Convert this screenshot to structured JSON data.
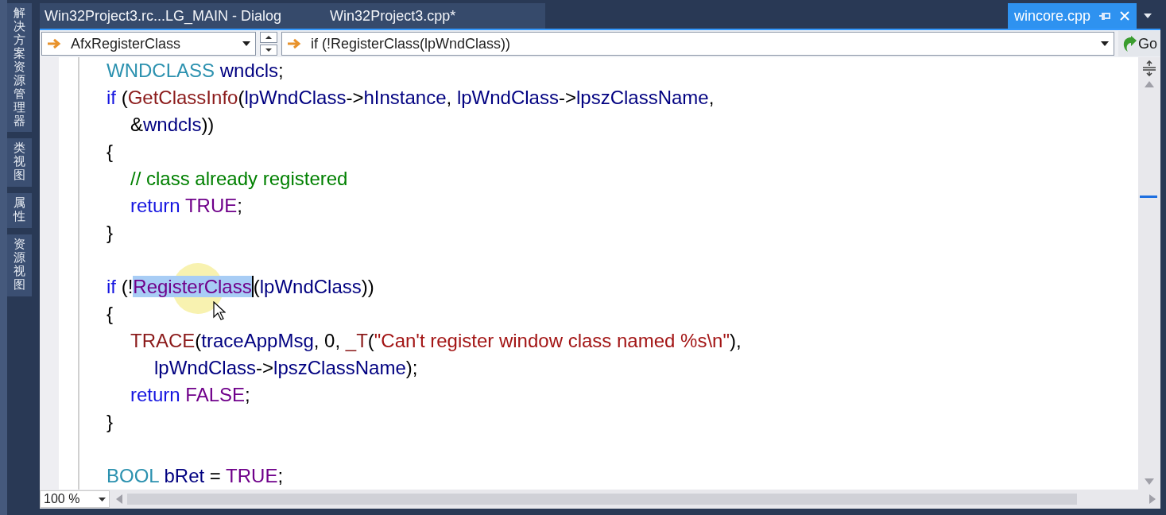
{
  "sidebar": {
    "tabs": [
      {
        "label": "解决方案资源管理器"
      },
      {
        "label": "类视图"
      },
      {
        "label": "属性"
      },
      {
        "label": "资源视图"
      }
    ]
  },
  "tabs": [
    {
      "label": "Win32Project3.rc...LG_MAIN - Dialog",
      "selected": false,
      "kind": "document"
    },
    {
      "label": "Win32Project3.cpp*",
      "selected": false,
      "kind": "document"
    },
    {
      "label": "wincore.cpp",
      "selected": true,
      "kind": "preview"
    }
  ],
  "navigation": {
    "member_dropdown": "AfxRegisterClass",
    "scope_dropdown": "if (!RegisterClass(lpWndClass))",
    "go_button": "Go"
  },
  "code_lines": [
    {
      "kind": "code",
      "tokens": [
        {
          "text": "WNDCLASS",
          "kind": "type"
        },
        {
          "text": " wndcls",
          "kind": "ident"
        },
        {
          "text": ";",
          "kind": "plain"
        }
      ]
    },
    {
      "kind": "code",
      "tokens": [
        {
          "text": "if",
          "kind": "keyword"
        },
        {
          "text": " (",
          "kind": "plain"
        },
        {
          "text": "GetClassInfo",
          "kind": "func"
        },
        {
          "text": "(",
          "kind": "plain"
        },
        {
          "text": "lpWndClass",
          "kind": "ident"
        },
        {
          "text": "->",
          "kind": "plain"
        },
        {
          "text": "hInstance",
          "kind": "ident"
        },
        {
          "text": ", ",
          "kind": "plain"
        },
        {
          "text": "lpWndClass",
          "kind": "ident"
        },
        {
          "text": "->",
          "kind": "plain"
        },
        {
          "text": "lpszClassName",
          "kind": "ident"
        },
        {
          "text": ",",
          "kind": "plain"
        }
      ]
    },
    {
      "kind": "code",
      "tokens": [
        {
          "text": "\t&",
          "kind": "plain"
        },
        {
          "text": "wndcls",
          "kind": "ident"
        },
        {
          "text": "))",
          "kind": "plain"
        }
      ]
    },
    {
      "kind": "code",
      "tokens": [
        {
          "text": "{",
          "kind": "plain"
        }
      ]
    },
    {
      "kind": "code",
      "tokens": [
        {
          "text": "\t// class already registered",
          "kind": "comment"
        }
      ]
    },
    {
      "kind": "code",
      "tokens": [
        {
          "text": "\treturn",
          "kind": "keyword"
        },
        {
          "text": " TRUE",
          "kind": "macro"
        },
        {
          "text": ";",
          "kind": "plain"
        }
      ]
    },
    {
      "kind": "code",
      "tokens": [
        {
          "text": "}",
          "kind": "plain"
        }
      ]
    },
    {
      "kind": "blank"
    },
    {
      "kind": "code",
      "tokens": [
        {
          "text": "if",
          "kind": "keyword"
        },
        {
          "text": " (!",
          "kind": "plain"
        },
        {
          "text": "RegisterClass",
          "kind": "selection"
        },
        {
          "text": "(",
          "kind": "plain"
        },
        {
          "text": "lpWndClass",
          "kind": "ident"
        },
        {
          "text": "))",
          "kind": "plain"
        }
      ]
    },
    {
      "kind": "code",
      "tokens": [
        {
          "text": "{",
          "kind": "plain"
        }
      ]
    },
    {
      "kind": "code",
      "tokens": [
        {
          "text": "\tTRACE",
          "kind": "func"
        },
        {
          "text": "(",
          "kind": "plain"
        },
        {
          "text": "traceAppMsg",
          "kind": "ident"
        },
        {
          "text": ", 0, ",
          "kind": "plain"
        },
        {
          "text": "_T",
          "kind": "func"
        },
        {
          "text": "(",
          "kind": "plain"
        },
        {
          "text": "\"Can't register window class named %s\\n\"",
          "kind": "string"
        },
        {
          "text": "),",
          "kind": "plain"
        }
      ]
    },
    {
      "kind": "code",
      "tokens": [
        {
          "text": "\t\tlpWndClass",
          "kind": "ident"
        },
        {
          "text": "->",
          "kind": "plain"
        },
        {
          "text": "lpszClassName",
          "kind": "ident"
        },
        {
          "text": ");",
          "kind": "plain"
        }
      ]
    },
    {
      "kind": "code",
      "tokens": [
        {
          "text": "\treturn",
          "kind": "keyword"
        },
        {
          "text": " FALSE",
          "kind": "macro"
        },
        {
          "text": ";",
          "kind": "plain"
        }
      ]
    },
    {
      "kind": "code",
      "tokens": [
        {
          "text": "}",
          "kind": "plain"
        }
      ]
    },
    {
      "kind": "blank"
    },
    {
      "kind": "code",
      "tokens": [
        {
          "text": "BOOL",
          "kind": "type"
        },
        {
          "text": " bRet",
          "kind": "ident"
        },
        {
          "text": " = ",
          "kind": "plain"
        },
        {
          "text": "TRUE",
          "kind": "macro"
        },
        {
          "text": ";",
          "kind": "plain"
        }
      ]
    }
  ],
  "zoom": "100 %"
}
